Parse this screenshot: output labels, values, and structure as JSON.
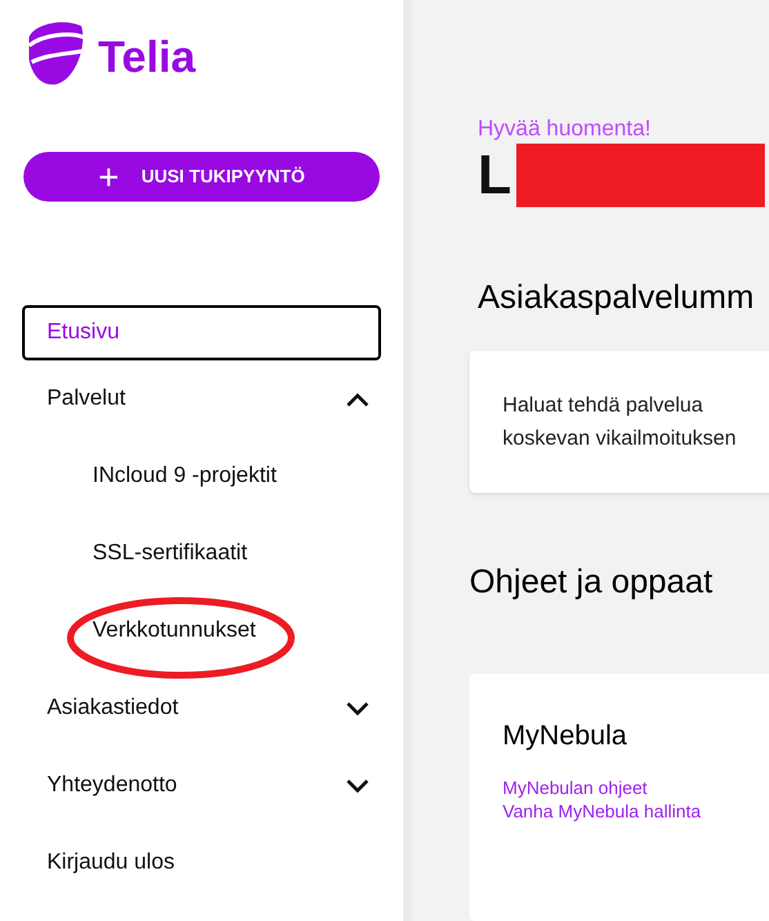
{
  "logo": {
    "text": "Telia"
  },
  "new_ticket_button": {
    "icon": "+",
    "label": "UUSI TUKIPYYNTÖ"
  },
  "nav": [
    {
      "label": "Etusivu",
      "selected": true,
      "kind": "link"
    },
    {
      "label": "Palvelut",
      "selected": false,
      "kind": "group",
      "expanded": true,
      "children": [
        {
          "label": "INcloud 9 -projektit",
          "highlighted": false
        },
        {
          "label": "SSL-sertifikaatit",
          "highlighted": false
        },
        {
          "label": "Verkkotunnukset",
          "highlighted": true
        }
      ]
    },
    {
      "label": "Asiakastiedot",
      "selected": false,
      "kind": "group",
      "expanded": false
    },
    {
      "label": "Yhteydenotto",
      "selected": false,
      "kind": "group",
      "expanded": false
    },
    {
      "label": "Kirjaudu ulos",
      "selected": false,
      "kind": "link"
    }
  ],
  "greeting": "Hyvää huomenta!",
  "user_name": {
    "visible": "L",
    "redacted": true
  },
  "customer_service": {
    "heading": "Asiakaspalvelumm",
    "card_text": "Haluat tehdä palvelua koskevan vikailmoituksen"
  },
  "guides": {
    "heading": "Ohjeet ja oppaat",
    "card": {
      "title": "MyNebula",
      "links": [
        "MyNebulan ohjeet",
        "Vanha MyNebula hallinta"
      ]
    }
  }
}
